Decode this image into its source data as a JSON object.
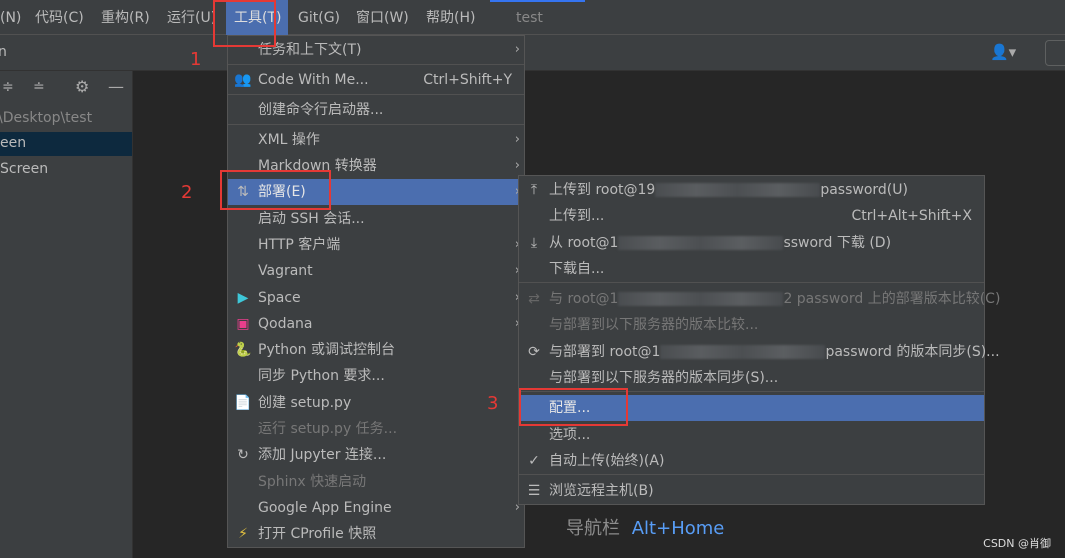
{
  "menubar": {
    "items": [
      "(N)",
      "代码(C)",
      "重构(R)",
      "运行(U)",
      "工具(T)",
      "Git(G)",
      "窗口(W)",
      "帮助(H)"
    ],
    "project_title": "test"
  },
  "toolbar": {
    "left_text": "n"
  },
  "project_panel": {
    "path": "\\Desktop\\test",
    "items": [
      "een",
      "Screen"
    ]
  },
  "tools_menu": [
    {
      "label": "任务和上下文(T)",
      "submenu": true
    },
    {
      "label": "Code With Me...",
      "shortcut": "Ctrl+Shift+Y",
      "icon": "code-with-me-icon"
    },
    {
      "label": "创建命令行启动器..."
    },
    {
      "label": "XML 操作",
      "submenu": true
    },
    {
      "label": "Markdown 转换器",
      "submenu": true
    },
    {
      "label": "部署(E)",
      "submenu": true,
      "selected": true,
      "icon": "deployment-icon"
    },
    {
      "label": "启动 SSH 会话..."
    },
    {
      "label": "HTTP 客户端",
      "submenu": true
    },
    {
      "label": "Vagrant",
      "submenu": true
    },
    {
      "label": "Space",
      "submenu": true,
      "icon": "space-icon"
    },
    {
      "label": "Qodana",
      "submenu": true,
      "icon": "qodana-icon"
    },
    {
      "label": "Python 或调试控制台",
      "icon": "python-console-icon"
    },
    {
      "label": "同步 Python 要求..."
    },
    {
      "label": "创建 setup.py",
      "icon": "setup-py-icon"
    },
    {
      "label": "运行 setup.py 任务...",
      "disabled": true
    },
    {
      "label": "添加 Jupyter 连接...",
      "icon": "jupyter-icon"
    },
    {
      "label": "Sphinx 快速启动",
      "disabled": true
    },
    {
      "label": "Google App Engine",
      "submenu": true
    },
    {
      "label": "打开 CProfile 快照",
      "icon": "cprofile-icon"
    }
  ],
  "deploy_menu": [
    {
      "pre": "上传到 root@19",
      "post": "password(U)",
      "icon": "upload-icon",
      "blurred": true
    },
    {
      "label": "上传到...",
      "shortcut": "Ctrl+Alt+Shift+X"
    },
    {
      "pre": "从 root@1",
      "post": "ssword 下载 (D)",
      "icon": "download-icon",
      "blurred": true
    },
    {
      "label": "下载自..."
    },
    {
      "pre": "与 root@1",
      "post": "2 password 上的部署版本比较(C)",
      "icon": "compare-icon",
      "blurred": true,
      "disabled": true
    },
    {
      "label": "与部署到以下服务器的版本比较...",
      "disabled": true
    },
    {
      "pre": "与部署到 root@1",
      "post": "password 的版本同步(S)...",
      "icon": "sync-icon",
      "blurred": true
    },
    {
      "label": "与部署到以下服务器的版本同步(S)..."
    },
    {
      "label": "配置...",
      "selected": true
    },
    {
      "label": "选项..."
    },
    {
      "label": "自动上传(始终)(A)",
      "icon": "check-icon"
    },
    {
      "label": "浏览远程主机(B)",
      "icon": "server-icon"
    }
  ],
  "annotations": [
    "1",
    "2",
    "3"
  ],
  "editor_hint": {
    "label": "导航栏",
    "shortcut": "Alt+Home"
  },
  "watermark": "CSDN @肖御",
  "colors": {
    "selection": "#4b6eaf",
    "annotation": "#e53935",
    "hint_shortcut": "#589df6"
  }
}
